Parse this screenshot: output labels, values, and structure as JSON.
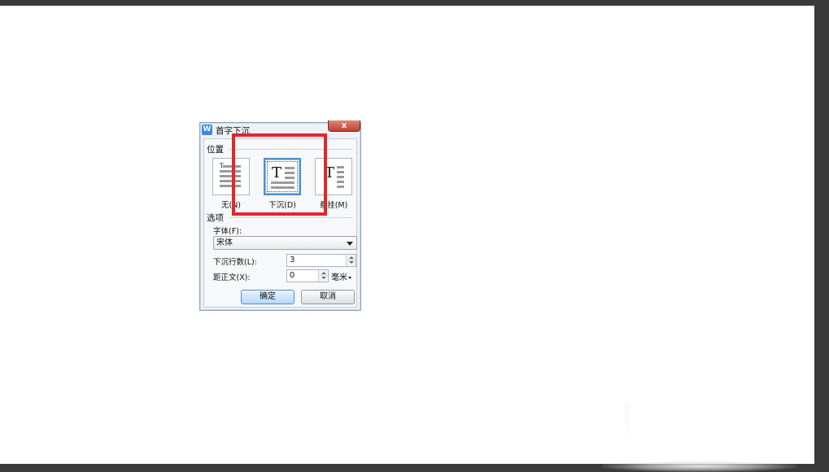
{
  "dialog": {
    "title": "首字下沉",
    "app_icon_letter": "W",
    "close_glyph": "x",
    "position_section": "位置",
    "position_options": [
      {
        "label": "无(N)",
        "selected": false
      },
      {
        "label": "下沉(D)",
        "selected": true
      },
      {
        "label": "悬挂(M)",
        "selected": false
      }
    ],
    "options_section": "选项",
    "font_label": "字体(F):",
    "font_value": "宋体",
    "lines_label": "下沉行数(L):",
    "lines_value": "3",
    "distance_label": "距正文(X):",
    "distance_value": "0",
    "distance_unit": "毫米",
    "ok_label": "确定",
    "cancel_label": "取消"
  },
  "colors": {
    "highlight": "#e2262b",
    "selection": "#4a90d9",
    "close_button": "#c0412c"
  }
}
